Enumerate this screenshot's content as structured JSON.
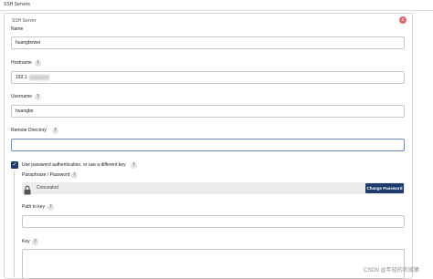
{
  "section": {
    "title": "SSH Servers",
    "card_title": "SSH Server"
  },
  "fields": {
    "name": {
      "label": "Name",
      "value": "huangbowei"
    },
    "hostname": {
      "label": "Hostname",
      "value": "192.1"
    },
    "username": {
      "label": "Username",
      "value": "huangbo"
    },
    "remote_directory": {
      "label": "Remote Directory",
      "value": ""
    }
  },
  "auth": {
    "checkbox_label": "Use password authentication, or use a different key",
    "checked": true,
    "passphrase_label": "Passphrase / Password",
    "passphrase_value": "Concealed",
    "change_password_button": "Change Password",
    "path_to_key_label": "Path to key",
    "path_to_key_value": "",
    "key_label": "Key"
  },
  "help_icon_glyph": "?",
  "delete_icon_glyph": "x",
  "watermark": "CSDN @年轻的农城猿",
  "colors": {
    "checkbox": "#1f3c6e",
    "change_password_bg": "#1f3c6e",
    "delete_icon": "#e06b6b",
    "focus_border": "#6b8dc0"
  }
}
